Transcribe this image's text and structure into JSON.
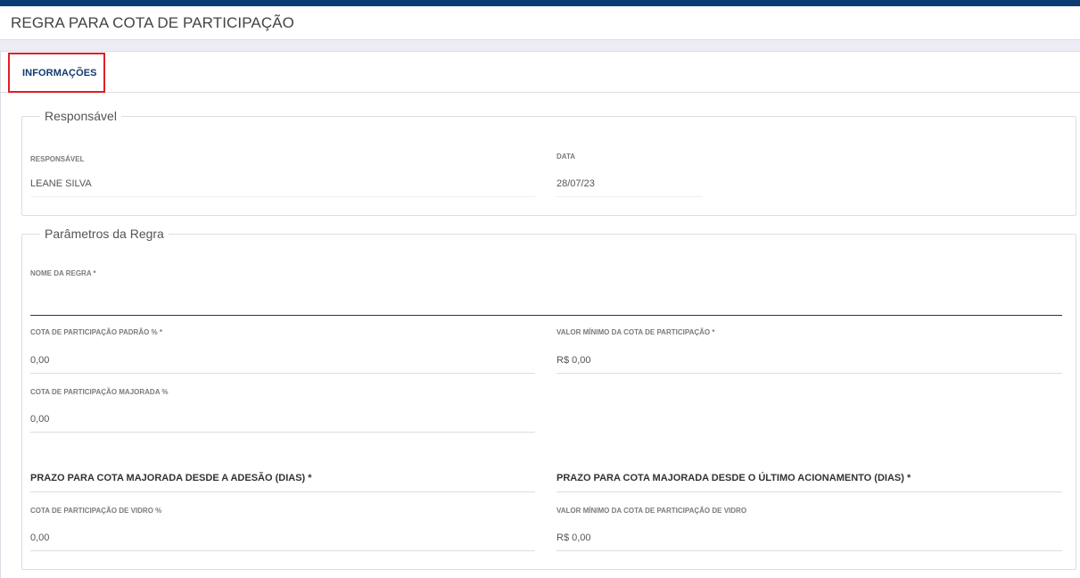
{
  "header": {
    "title": "REGRA PARA COTA DE PARTICIPAÇÃO"
  },
  "tabs": [
    {
      "label": "INFORMAÇÕES"
    }
  ],
  "responsavel_section": {
    "legend": "Responsável",
    "responsavel": {
      "label": "RESPONSÁVEL",
      "value": "LEANE SILVA"
    },
    "data": {
      "label": "DATA",
      "value": "28/07/23"
    }
  },
  "parametros_section": {
    "legend": "Parâmetros da Regra",
    "nome_regra": {
      "label": "NOME DA REGRA *",
      "value": ""
    },
    "cota_padrao": {
      "label": "COTA DE PARTICIPAÇÃO PADRÃO % *",
      "value": "0,00"
    },
    "valor_minimo": {
      "label": "VALOR MÍNIMO DA COTA DE PARTICIPAÇÃO *",
      "value": "R$ 0,00"
    },
    "cota_majorada": {
      "label": "COTA DE PARTICIPAÇÃO MAJORADA %",
      "value": "0,00"
    },
    "prazo_adesao": {
      "label": "PRAZO PARA COTA MAJORADA DESDE A ADESÃO (DIAS) *",
      "value": ""
    },
    "prazo_acionamento": {
      "label": "PRAZO PARA COTA MAJORADA DESDE O ÚLTIMO ACIONAMENTO (DIAS) *",
      "value": ""
    },
    "cota_vidro": {
      "label": "COTA DE PARTICIPAÇÃO DE VIDRO %",
      "value": "0,00"
    },
    "valor_minimo_vidro": {
      "label": "VALOR MÍNIMO DA COTA DE PARTICIPAÇÃO DE VIDRO",
      "value": "R$ 0,00"
    }
  },
  "colors": {
    "brand": "#0d3b73",
    "tab_highlight": "#e11e26",
    "tab_text": "#123a6e"
  }
}
